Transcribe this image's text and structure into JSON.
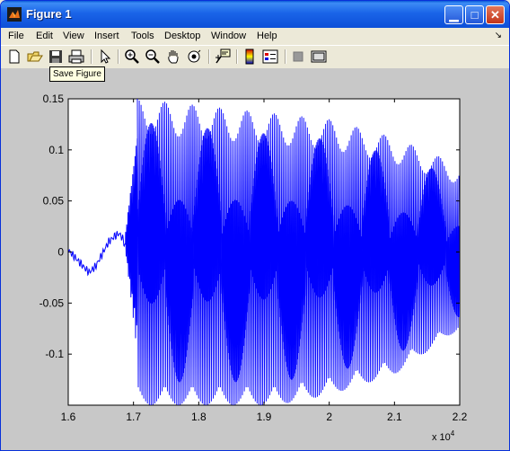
{
  "window": {
    "title": "Figure 1",
    "icons": [
      "matlab-icon"
    ],
    "controls": [
      "minimize-icon",
      "maximize-icon",
      "close-icon"
    ]
  },
  "menu": [
    {
      "label": "File",
      "accel": "F"
    },
    {
      "label": "Edit",
      "accel": "E"
    },
    {
      "label": "View",
      "accel": "V"
    },
    {
      "label": "Insert",
      "accel": "I"
    },
    {
      "label": "Tools",
      "accel": "T"
    },
    {
      "label": "Desktop",
      "accel": "D"
    },
    {
      "label": "Window",
      "accel": "W"
    },
    {
      "label": "Help",
      "accel": "H"
    }
  ],
  "toolbar": {
    "tools": [
      "new-figure-icon",
      "open-file-icon",
      "save-icon",
      "print-icon",
      "pointer-icon",
      "zoom-in-icon",
      "zoom-out-icon",
      "pan-hand-icon",
      "rotate-3d-icon",
      "data-cursor-icon",
      "colorbar-icon",
      "legend-icon",
      "hide-plot-tools-icon",
      "show-plot-tools-icon"
    ]
  },
  "tooltip": "Save Figure",
  "colors": {
    "titlebar": "#0a5ad7",
    "plot_line": "#0000ff",
    "figure_bg": "#c8c8c8"
  },
  "chart_data": {
    "type": "line",
    "title": "",
    "xlabel": "",
    "ylabel": "",
    "xlim": [
      16000,
      22000
    ],
    "ylim": [
      -0.15,
      0.15
    ],
    "x_ticks": [
      "1.6",
      "1.7",
      "1.8",
      "1.9",
      "2",
      "2.1",
      "2.2"
    ],
    "y_ticks": [
      "0.15",
      "0.1",
      "0.05",
      "0",
      "-0.05",
      "-0.1"
    ],
    "x_exponent_label": "x 10",
    "x_exponent_power": "4",
    "series": [
      {
        "color": "#0000ff",
        "pre_onset_points": [
          [
            16000,
            0.002
          ],
          [
            16100,
            -0.005
          ],
          [
            16200,
            -0.012
          ],
          [
            16320,
            -0.02
          ],
          [
            16420,
            -0.014
          ],
          [
            16520,
            -0.002
          ],
          [
            16620,
            0.01
          ],
          [
            16720,
            0.016
          ],
          [
            16780,
            0.018
          ],
          [
            16830,
            0.014
          ],
          [
            16870,
            0.006
          ]
        ],
        "onset_x": 16880,
        "oscillation_start_x": 17060,
        "oscillation_end_x": 22000,
        "envelope_upper": [
          [
            17060,
            0.15
          ],
          [
            20000,
            0.13
          ],
          [
            21000,
            0.112
          ],
          [
            22000,
            0.085
          ]
        ],
        "envelope_lower": [
          [
            17060,
            -0.15
          ],
          [
            19200,
            -0.15
          ],
          [
            20000,
            -0.14
          ],
          [
            21000,
            -0.12
          ],
          [
            22000,
            -0.075
          ]
        ]
      }
    ],
    "grid": false
  }
}
